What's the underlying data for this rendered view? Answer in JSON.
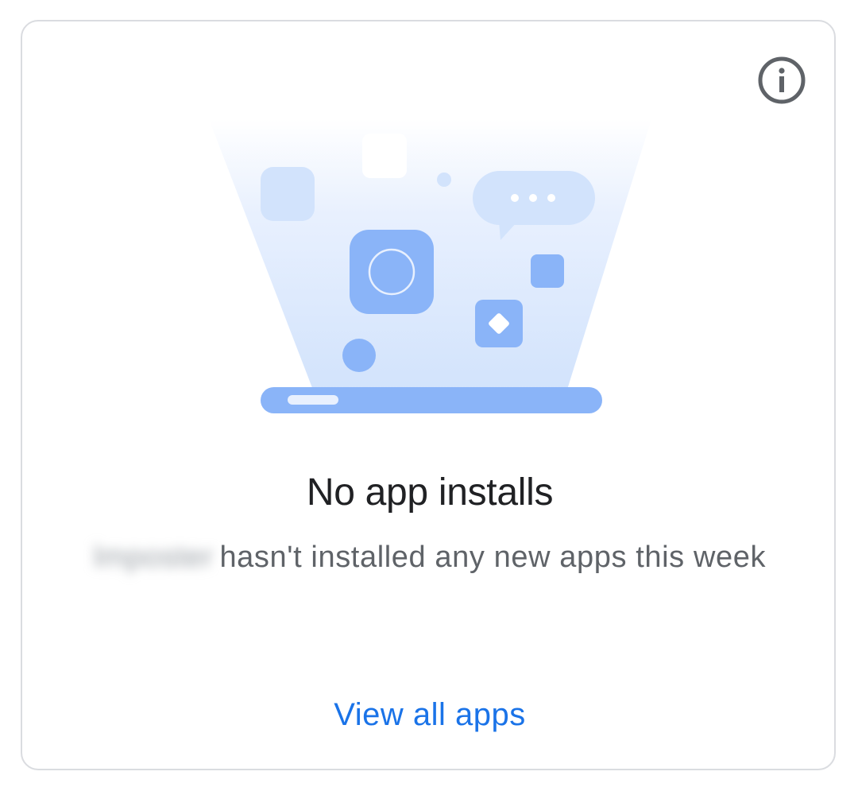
{
  "card": {
    "info_icon": "info-outline-icon",
    "illustration": "app-installs-illustration",
    "title": "No app installs",
    "subtitle": {
      "blurred_name": "lmposter",
      "text": "hasn't installed any new apps this week"
    },
    "link_label": "View all apps"
  },
  "colors": {
    "accent": "#1a73e8",
    "title": "#202124",
    "subtitle": "#5f6368",
    "border": "#dadce0",
    "illustration_primary": "#8ab4f8",
    "illustration_light": "#d2e3fc"
  }
}
